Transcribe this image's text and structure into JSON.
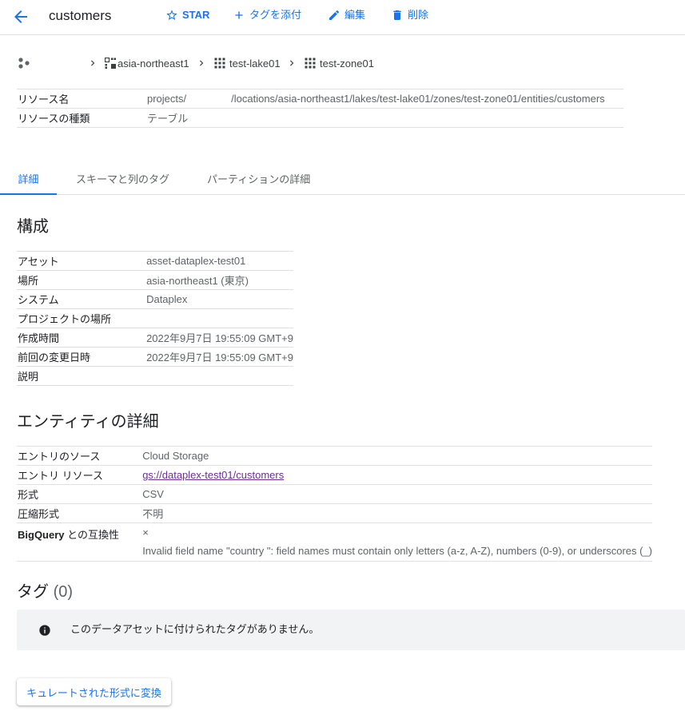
{
  "header": {
    "title": "customers",
    "star_label": "STAR",
    "add_tag_label": "タグを添付",
    "edit_label": "編集",
    "delete_label": "削除"
  },
  "breadcrumb": {
    "region": "asia-northeast1",
    "lake": "test-lake01",
    "zone": "test-zone01"
  },
  "resource": {
    "rows": [
      {
        "key": "リソース名",
        "value_prefix": "projects/",
        "value_suffix": "/locations/asia-northeast1/lakes/test-lake01/zones/test-zone01/entities/customers"
      },
      {
        "key": "リソースの種類",
        "value": "テーブル"
      }
    ]
  },
  "tabs": [
    "詳細",
    "スキーマと列のタグ",
    "パーティションの詳細"
  ],
  "config": {
    "heading": "構成",
    "rows": [
      {
        "key": "アセット",
        "value": "asset-dataplex-test01"
      },
      {
        "key": "場所",
        "value": "asia-northeast1 (東京)"
      },
      {
        "key": "システム",
        "value": "Dataplex"
      },
      {
        "key": "プロジェクトの場所",
        "value": ""
      },
      {
        "key": "作成時間",
        "value": "2022年9月7日 19:55:09 GMT+9"
      },
      {
        "key": "前回の変更日時",
        "value": "2022年9月7日 19:55:09 GMT+9"
      },
      {
        "key": "説明",
        "value": ""
      }
    ]
  },
  "entity": {
    "heading": "エンティティの詳細",
    "rows": [
      {
        "key": "エントリのソース",
        "value": "Cloud Storage"
      },
      {
        "key": "エントリ リソース",
        "value": "gs://dataplex-test01/customers"
      },
      {
        "key": "形式",
        "value": "CSV"
      },
      {
        "key": "圧縮形式",
        "value": "不明"
      }
    ],
    "compat_key_bold": "BigQuery",
    "compat_key_rest": " との互換性",
    "compat_mark": "×",
    "compat_error": "Invalid field name \"country \": field names must contain only letters (a-z, A-Z), numbers (0-9), or underscores (_)"
  },
  "tags": {
    "heading": "タグ",
    "count": "(0)",
    "empty_message": "このデータアセットに付けられたタグがありません。"
  },
  "convert_button": "キュレートされた形式に変換",
  "colors": {
    "accent": "#1a73e8",
    "link_visited": "#6b2d9a",
    "info_bg": "#f1f3f4"
  },
  "icons": [
    "back-arrow-icon",
    "star-icon",
    "plus-icon",
    "pencil-icon",
    "trash-icon",
    "dataplex-icon",
    "chevron-right-icon",
    "region-grid-icon",
    "lake-grid-icon",
    "zone-grid-icon",
    "info-icon"
  ]
}
